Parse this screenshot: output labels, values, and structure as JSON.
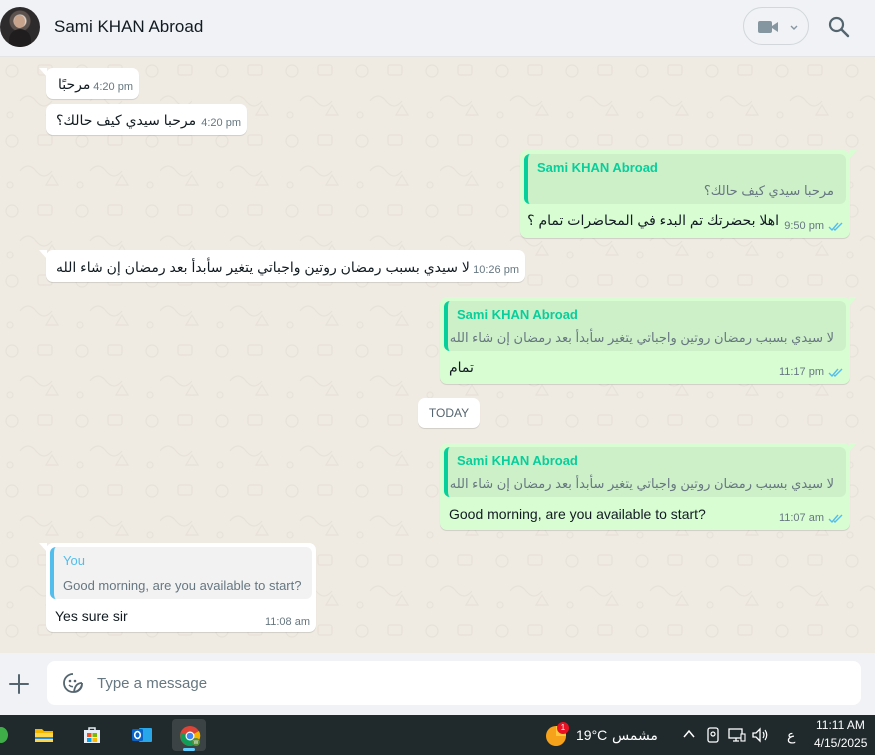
{
  "header": {
    "contact_name": "Sami KHAN Abroad",
    "icons": [
      "avatar",
      "video-call-icon",
      "chevron-down-icon",
      "search-icon"
    ]
  },
  "messages": [
    {
      "dir": "in",
      "text": "مرحبًا",
      "time": "4:20 pm"
    },
    {
      "dir": "in",
      "text": "مرحبا سيدي كيف حالك؟",
      "time": "4:20 pm"
    },
    {
      "dir": "out",
      "quote_author": "Sami KHAN Abroad",
      "quote_text": "مرحبا سيدي كيف حالك؟",
      "text": "اهلا بحضرتك تم البدء في المحاضرات تمام ؟",
      "time": "9:50 pm",
      "status": "read"
    },
    {
      "dir": "in",
      "text": "لا سيدي بسبب رمضان روتين واجباتي يتغير سأبدأ بعد رمضان إن شاء الله",
      "time": "10:26 pm"
    },
    {
      "dir": "out",
      "quote_author": "Sami KHAN Abroad",
      "quote_text": "لا سيدي بسبب رمضان روتين واجباتي يتغير سأبدأ بعد رمضان إن شاء الله",
      "text": "تمام",
      "time": "11:17 pm",
      "status": "read"
    },
    {
      "dir": "out",
      "quote_author": "Sami KHAN Abroad",
      "quote_text": "لا سيدي بسبب رمضان روتين واجباتي يتغير سأبدأ بعد رمضان إن شاء الله",
      "text": "Good morning, are you available to start?",
      "time": "11:07 am",
      "status": "read"
    },
    {
      "dir": "in",
      "quote_author": "You",
      "quote_text": "Good morning, are you available to start?",
      "text": "Yes sure sir",
      "time": "11:08 am"
    }
  ],
  "date_divider": "TODAY",
  "compose": {
    "placeholder": "Type a message"
  },
  "colors": {
    "chat_bg": "#efeae2",
    "incoming": "#ffffff",
    "outgoing": "#d9fdd3",
    "accent": "#06cf9c",
    "read_ticks": "#53bdeb"
  },
  "taskbar": {
    "apps": [
      "file-explorer-icon",
      "microsoft-store-icon",
      "outlook-icon",
      "chrome-icon"
    ],
    "weather_badge": "1",
    "temperature": "19°C",
    "condition": "مشمس",
    "language": "ع",
    "time": "11:11 AM",
    "date": "4/15/2025"
  }
}
